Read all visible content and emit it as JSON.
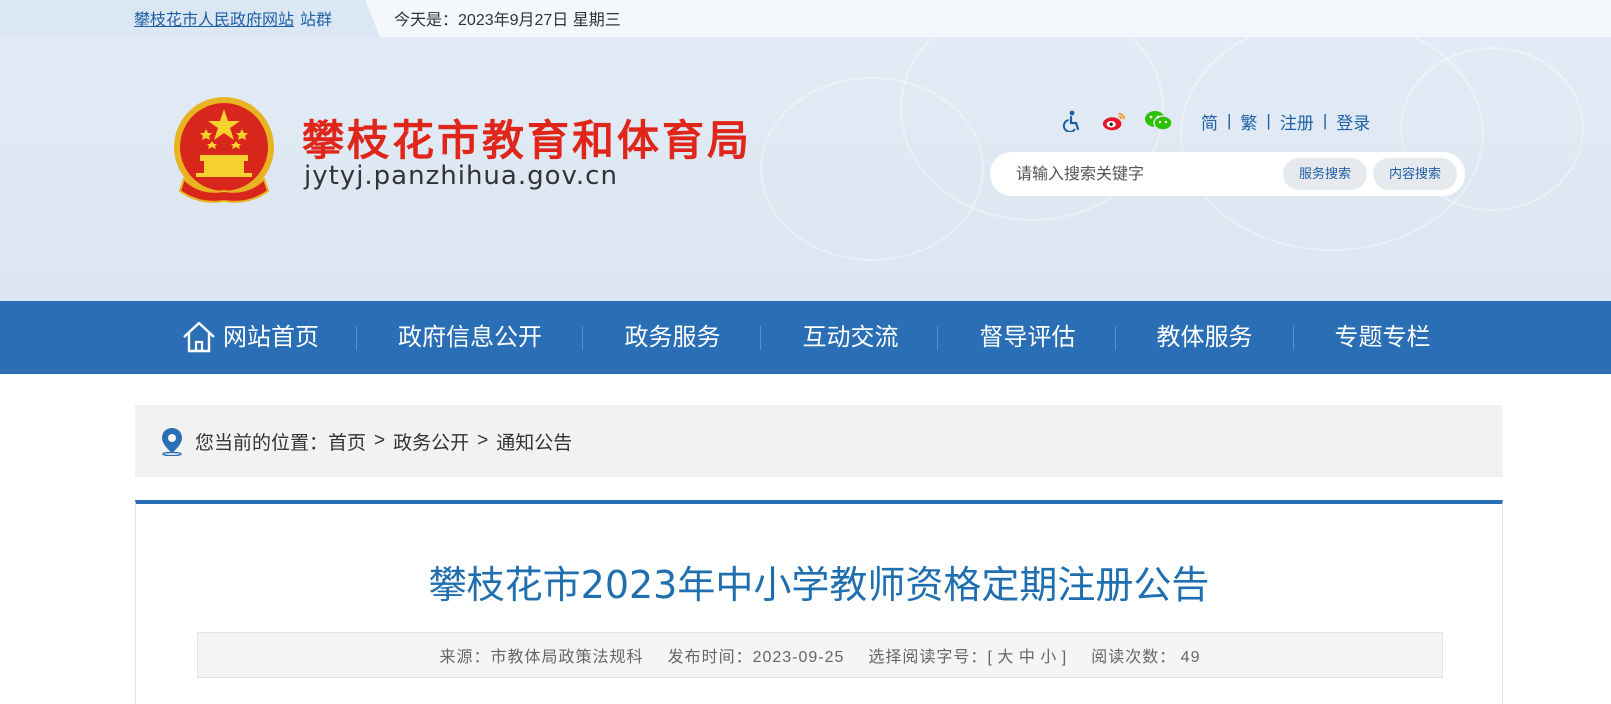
{
  "topbar": {
    "gov_link": "攀枝花市人民政府网站",
    "station_group": "站群",
    "date_label": "今天是：",
    "date_value": "2023年9月27日 星期三"
  },
  "header": {
    "title": "攀枝花市教育和体育局",
    "domain": "jytyj.panzhihua.gov.cn",
    "tools": {
      "icons": [
        "accessibility-icon",
        "weibo-icon",
        "wechat-icon"
      ],
      "simplified": "简",
      "traditional": "繁",
      "register": "注册",
      "login": "登录",
      "divider": "|"
    },
    "search": {
      "placeholder": "请输入搜索关键字",
      "service_search": "服务搜索",
      "content_search": "内容搜索"
    }
  },
  "nav": {
    "items": [
      "网站首页",
      "政府信息公开",
      "政务服务",
      "互动交流",
      "督导评估",
      "教体服务",
      "专题专栏"
    ]
  },
  "breadcrumb": {
    "label": "您当前的位置：",
    "items": [
      "首页",
      "政务公开",
      "通知公告"
    ],
    "separator": ">"
  },
  "article": {
    "title": "攀枝花市2023年中小学教师资格定期注册公告",
    "meta": {
      "source_label": "来源：",
      "source": "市教体局政策法规科",
      "publish_label": "发布时间：",
      "publish_date": "2023-09-25",
      "font_label": "选择阅读字号：",
      "font_open": "[",
      "font_large": "大",
      "font_medium": "中",
      "font_small": "小",
      "font_close": "]",
      "views_label": "阅读次数：",
      "views": "49"
    }
  },
  "colors": {
    "brand_blue": "#2a6fb5",
    "title_red": "#e0261a",
    "link_blue": "#1f5fa5"
  }
}
